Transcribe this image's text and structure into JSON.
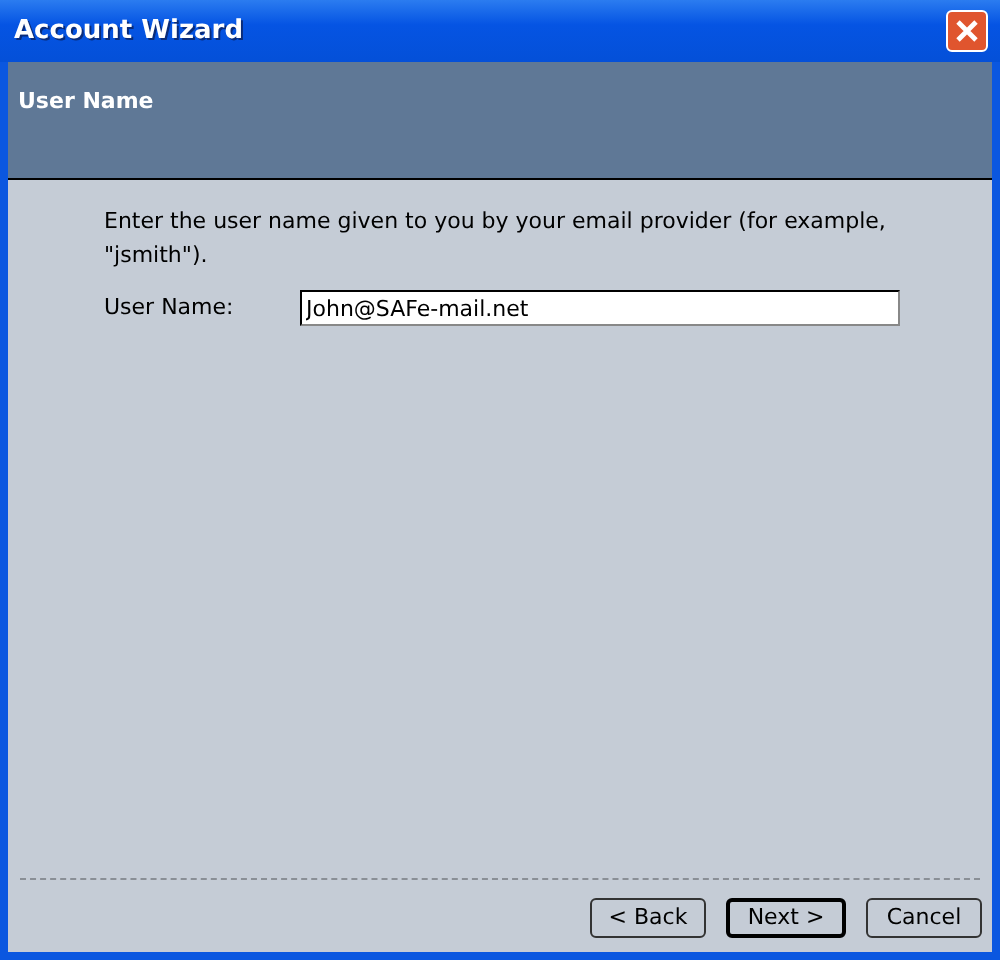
{
  "window": {
    "title": "Account Wizard"
  },
  "header": {
    "title": "User Name"
  },
  "instruction": "Enter the user name given to you by your email provider (for example, \"jsmith\").",
  "fields": [
    {
      "label": "User Name:",
      "value": "John@SAFe-mail.net"
    }
  ],
  "buttons": [
    {
      "label": "< Back",
      "default": false
    },
    {
      "label": "Next >",
      "default": true
    },
    {
      "label": "Cancel",
      "default": false
    }
  ]
}
